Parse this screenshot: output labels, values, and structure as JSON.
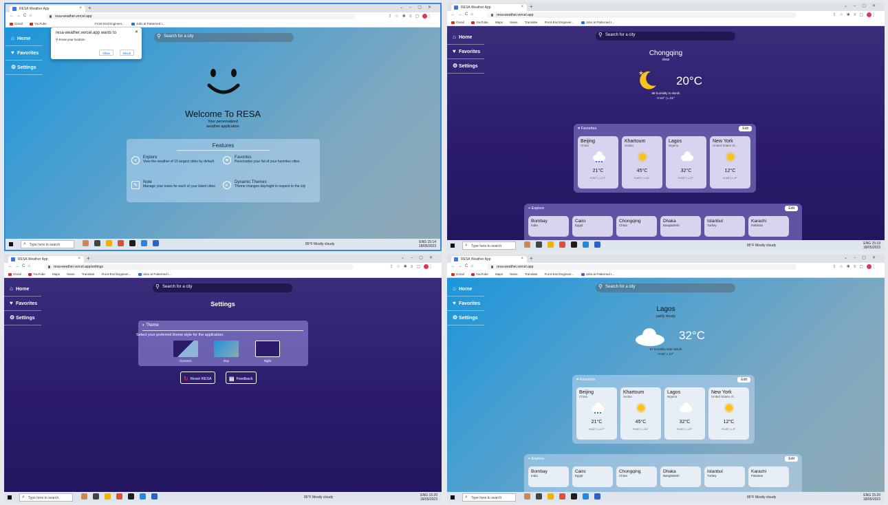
{
  "browser": {
    "tab_title": "RESA Weather App",
    "bookmarks": [
      "Gmail",
      "YouTube",
      "Maps",
      "News",
      "Translate",
      "Front-End Engineer...",
      "Jobs at Patterned I..."
    ]
  },
  "sidebar": {
    "home": "Home",
    "favorites": "Favorites",
    "settings": "Settings"
  },
  "search_placeholder": "Search for a city",
  "taskbar": {
    "search": "Type here to search",
    "weather": "85°F Mostly cloudy",
    "lang": "ENG",
    "date": "18/05/2023"
  },
  "q0": {
    "url": "resa-weather.vercel.app",
    "popup": {
      "title": "resa-weather.vercel.app wants to",
      "item": "Know your location",
      "allow": "Allow",
      "block": "Block"
    },
    "welcome_title": "Welcome To RESA",
    "welcome_sub1": "Your personalized",
    "welcome_sub2": "weather application",
    "features_title": "Features",
    "features": [
      {
        "title": "Explore",
        "desc": "View the weather of 15 largest cities by default"
      },
      {
        "title": "Favorites",
        "desc": "Personalize your list of your favorites cities"
      },
      {
        "title": "Note",
        "desc": "Manage your notes for each of your listed cities"
      },
      {
        "title": "Dynamic Themes",
        "desc": "Theme changes day/night in respect to the city"
      }
    ],
    "time": "15:14"
  },
  "q1": {
    "url": "resa-weather.vercel.app",
    "city": "Chongqing",
    "cond": "clear",
    "temp": "20°C",
    "details": "88 humidity  N 4km/h",
    "hl": "H:24° | L:21°",
    "time": "15:19"
  },
  "q2": {
    "url": "resa-weather.vercel.app/settings",
    "title": "Settings",
    "theme_label": "Theme",
    "theme_desc": "Select your preferred theme style for the application:",
    "options": [
      "Dynamic",
      "Day",
      "Night"
    ],
    "reset": "Reset RESA",
    "feedback": "Feedback",
    "time": "15:20"
  },
  "q3": {
    "url": "resa-weather.vercel.app",
    "city": "Lagos",
    "cond": "partly cloudy",
    "temp": "32°C",
    "details": "67 humidity  SSE 6km/h",
    "hl": "H:28° L:27°",
    "time": "15:20"
  },
  "favorites": {
    "title": "Favorites",
    "edit": "Edit",
    "cities": [
      {
        "name": "Beijing",
        "country": "China",
        "temp": "21°C",
        "hl": "H:32° | L:17°",
        "icon": "rain"
      },
      {
        "name": "Khartoum",
        "country": "Sudan",
        "temp": "45°C",
        "hl": "H:45° | L:31°",
        "icon": "sun"
      },
      {
        "name": "Lagos",
        "country": "Nigeria",
        "temp": "32°C",
        "hl": "H:28° | L:27°",
        "icon": "cloud"
      },
      {
        "name": "New York",
        "country": "United States of...",
        "temp": "12°C",
        "hl": "H:18° | L:9°",
        "icon": "sun"
      }
    ]
  },
  "explore": {
    "title": "Explore",
    "edit": "Edit",
    "cities": [
      {
        "name": "Bombay",
        "country": "India"
      },
      {
        "name": "Cairo",
        "country": "Egypt"
      },
      {
        "name": "Chongqing",
        "country": "China"
      },
      {
        "name": "Dhaka",
        "country": "Bangladesh"
      },
      {
        "name": "Istanbul",
        "country": "Turkey"
      },
      {
        "name": "Karachi",
        "country": "Pakistan"
      }
    ]
  }
}
